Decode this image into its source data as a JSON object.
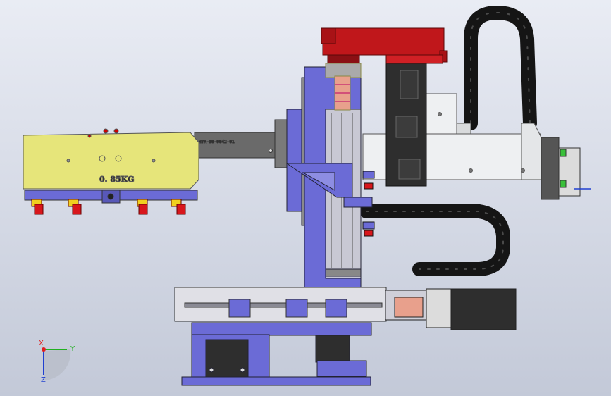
{
  "model": {
    "weight_label": "0. 85KG",
    "part_number": "HYR-30-0042-01"
  },
  "triad": {
    "axis_x": "X",
    "axis_y": "Y",
    "axis_z": "Z",
    "color_x": "#e02020",
    "color_y": "#20b020",
    "color_z": "#2040d0"
  },
  "colors": {
    "frame_blue": "#6b6bd6",
    "payload_yellow": "#e6e57a",
    "motor_red": "#c0171b",
    "housing_white": "#eef0f2",
    "dark_block": "#2e2e2e",
    "coupling": "#e8a08c",
    "cable_chain": "#151515"
  }
}
